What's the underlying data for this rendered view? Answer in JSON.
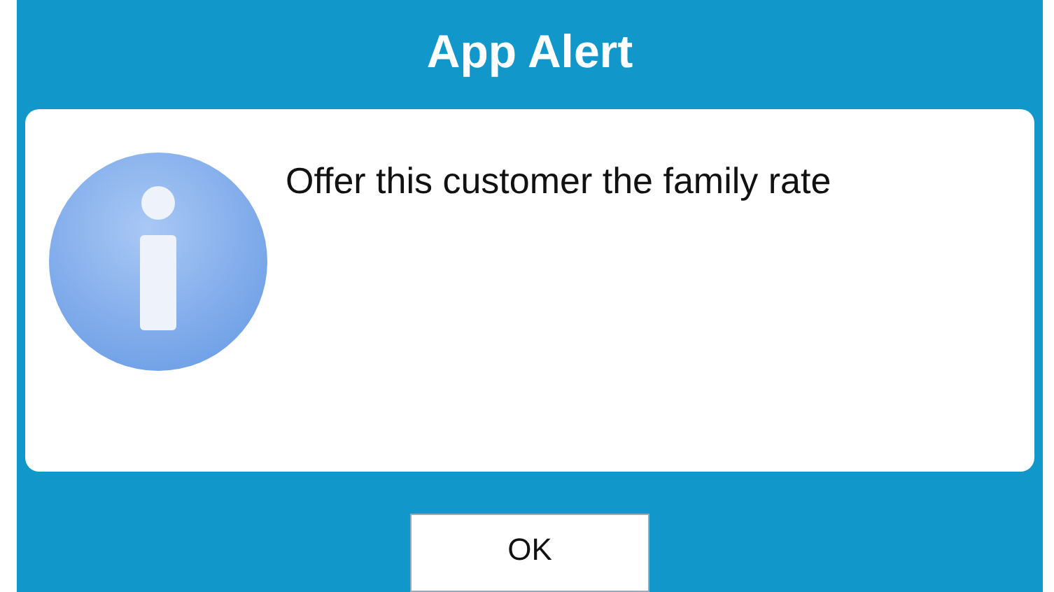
{
  "dialog": {
    "title": "App Alert",
    "message": "Offer this customer the family rate",
    "buttons": [
      "OK"
    ]
  }
}
